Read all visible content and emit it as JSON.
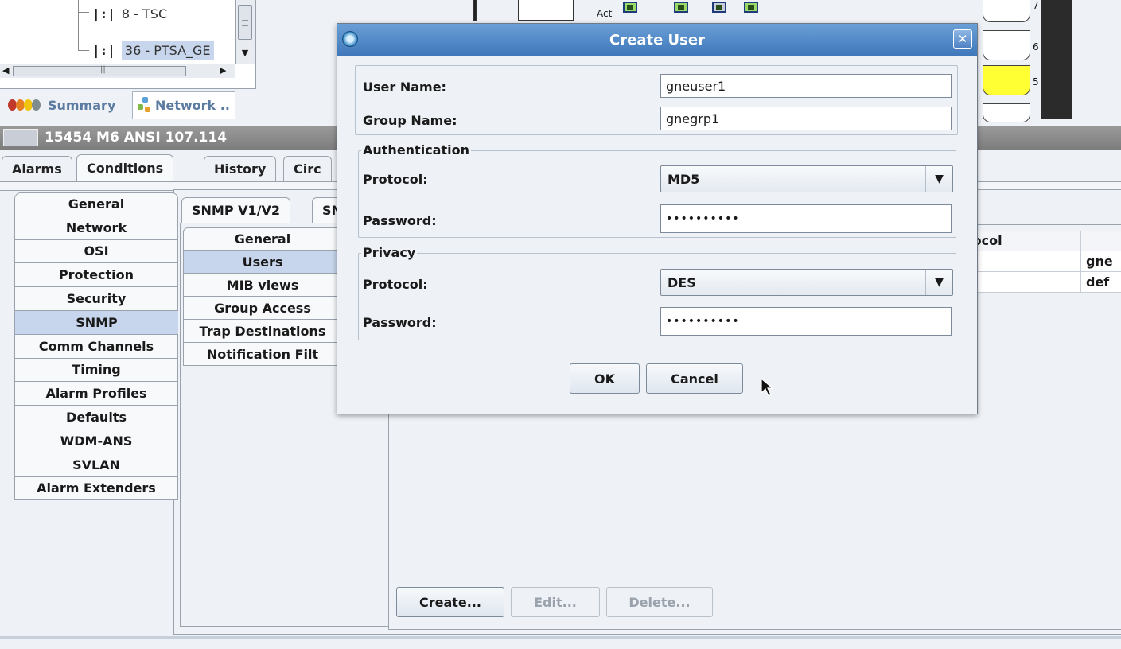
{
  "tree": {
    "items": [
      {
        "icon": "|:|",
        "label": "8 - TSC"
      },
      {
        "icon": "|:|",
        "label": "36 - PTSA_GE"
      }
    ]
  },
  "view_tabs": {
    "summary": "Summary",
    "network": "Network .."
  },
  "node_header": "15454 M6 ANSI 107.114",
  "main_tabs": [
    "Alarms",
    "Conditions",
    "History",
    "Circ"
  ],
  "prov_tabs": [
    "General",
    "Network",
    "OSI",
    "Protection",
    "Security",
    "SNMP",
    "Comm Channels",
    "Timing",
    "Alarm Profiles",
    "Defaults",
    "WDM-ANS",
    "SVLAN",
    "Alarm Extenders"
  ],
  "snmp_tabs": [
    "SNMP V1/V2",
    "SN"
  ],
  "snmp_sub_tabs": [
    "General",
    "Users",
    "MIB views",
    "Group Access",
    "Trap Destinations",
    "Notification Filt"
  ],
  "users_table": {
    "header_protocol": "tocol",
    "rows": [
      "gne",
      "def"
    ]
  },
  "bottom_buttons": {
    "create": "Create...",
    "edit": "Edit...",
    "delete": "Delete..."
  },
  "shelf": {
    "act_label": "Act",
    "rack_numbers": [
      "7",
      "6",
      "5"
    ]
  },
  "dialog": {
    "title": "Create User",
    "user_name_label": "User Name:",
    "user_name_value": "gneuser1",
    "group_name_label": "Group Name:",
    "group_name_value": "gnegrp1",
    "auth_legend": "Authentication",
    "auth_protocol_label": "Protocol:",
    "auth_protocol_value": "MD5",
    "auth_password_label": "Password:",
    "auth_password_value": "••••••••••",
    "privacy_legend": "Privacy",
    "priv_protocol_label": "Protocol:",
    "priv_protocol_value": "DES",
    "priv_password_label": "Password:",
    "priv_password_value": "••••••••••",
    "ok": "OK",
    "cancel": "Cancel"
  }
}
